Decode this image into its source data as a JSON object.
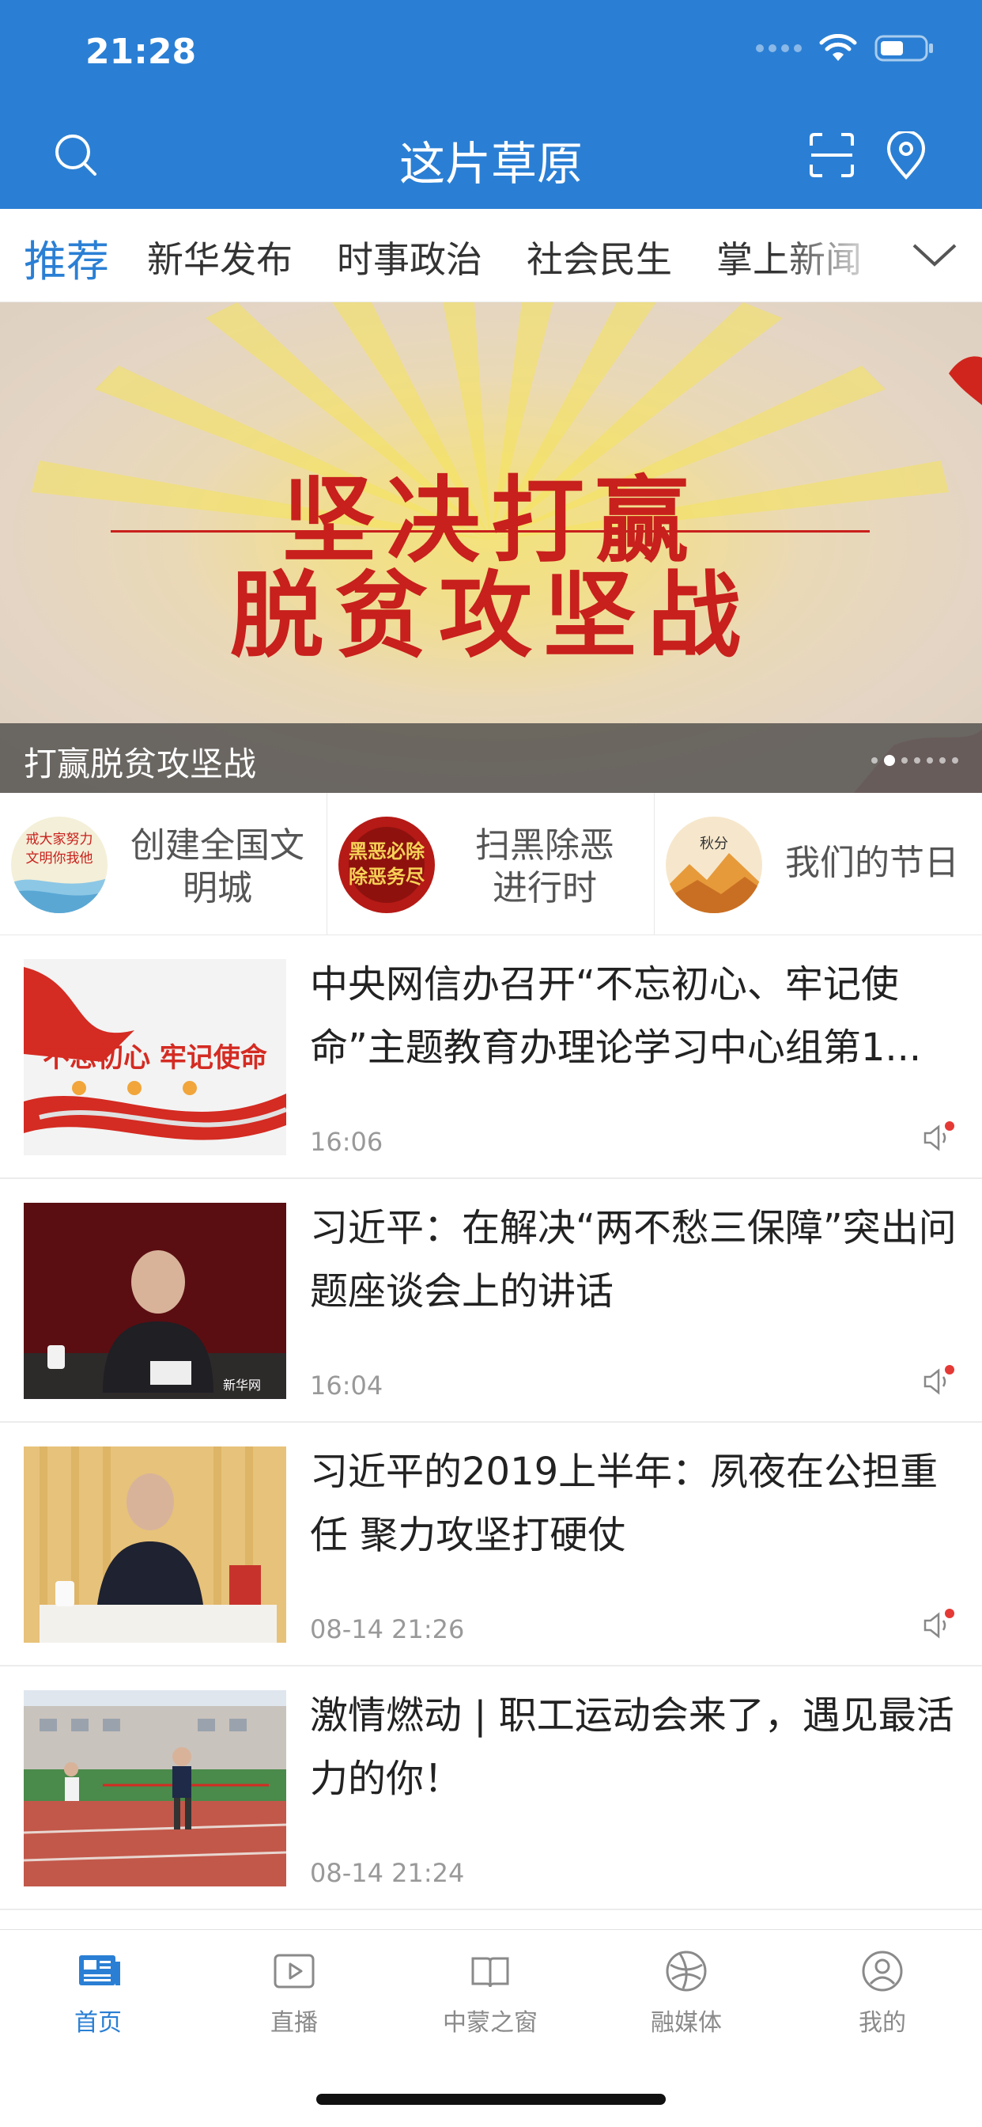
{
  "status_bar": {
    "time": "21:28"
  },
  "header": {
    "title": "这片草原"
  },
  "tabs": [
    {
      "label": "推荐",
      "active": true
    },
    {
      "label": "新华发布",
      "active": false
    },
    {
      "label": "时事政治",
      "active": false
    },
    {
      "label": "社会民生",
      "active": false
    },
    {
      "label": "掌上新闻",
      "active": false
    }
  ],
  "banner": {
    "headline_line1": "坚决打赢",
    "headline_line2": "脱贫攻坚战",
    "caption": "打赢脱贫攻坚战",
    "carousel": {
      "current": 2,
      "total": 7
    }
  },
  "topics": [
    {
      "label_line1": "创建全国文",
      "label_line2": "明城",
      "badge_text": "戒大家努力 文明你我他"
    },
    {
      "label_line1": "扫黑除恶",
      "label_line2": "进行时",
      "badge_text": "黑恶必除 除恶务尽"
    },
    {
      "label_line1": "我们的节日",
      "label_line2": "",
      "badge_text": "秋分"
    }
  ],
  "news": [
    {
      "title": "中央网信办召开“不忘初心、牢记使命”主题教育办理论学习中心组第1...",
      "time": "16:06",
      "thumb_text": "不忘初心 牢记使命"
    },
    {
      "title": "习近平：在解决“两不愁三保障”突出问题座谈会上的讲话",
      "time": "16:04",
      "thumb_text": "新华网"
    },
    {
      "title": "习近平的2019上半年：夙夜在公担重任 聚力攻坚打硬仗",
      "time": "08-14 21:26",
      "thumb_text": ""
    },
    {
      "title": "激情燃动 | 职工运动会来了，遇见最活力的你！",
      "time": "08-14 21:24",
      "thumb_text": ""
    }
  ],
  "bottom_nav": [
    {
      "label": "首页",
      "icon": "news-icon",
      "active": true
    },
    {
      "label": "直播",
      "icon": "play-icon",
      "active": false
    },
    {
      "label": "中蒙之窗",
      "icon": "book-icon",
      "active": false
    },
    {
      "label": "融媒体",
      "icon": "globe-icon",
      "active": false
    },
    {
      "label": "我的",
      "icon": "user-icon",
      "active": false
    }
  ],
  "colors": {
    "brand_blue": "#2a7fd4",
    "banner_red": "#c8201c",
    "unread_dot": "#e53935"
  }
}
